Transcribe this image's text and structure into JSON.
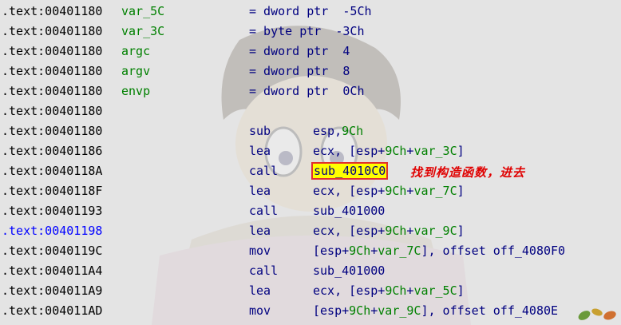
{
  "annotation": "找到构造函数，进去",
  "accent_colors": {
    "highlight": "#ffff00",
    "box": "#e03030",
    "annotation": "#e00000"
  },
  "rows": [
    {
      "addr": ".text:00401180",
      "name": "var_5C",
      "eq": "=",
      "type": "dword ptr",
      "val": "-5Ch"
    },
    {
      "addr": ".text:00401180",
      "name": "var_3C",
      "eq": "=",
      "type": "byte ptr",
      "val": "-3Ch"
    },
    {
      "addr": ".text:00401180",
      "name": "argc",
      "eq": "=",
      "type": "dword ptr",
      "val": "4"
    },
    {
      "addr": ".text:00401180",
      "name": "argv",
      "eq": "=",
      "type": "dword ptr",
      "val": "8"
    },
    {
      "addr": ".text:00401180",
      "name": "envp",
      "eq": "=",
      "type": "dword ptr",
      "val": "0Ch"
    },
    {
      "addr": ".text:00401180"
    },
    {
      "addr": ".text:00401180",
      "mnem": "sub",
      "op1": "esp,",
      "op1num": "9Ch"
    },
    {
      "addr": ".text:00401186",
      "mnem": "lea",
      "op1": "ecx, [esp+",
      "op1num": "9Ch",
      "op1plus": "+",
      "op1ref": "var_3C",
      "op1end": "]"
    },
    {
      "addr": ".text:0040118A",
      "mnem": "call",
      "call": "sub_4010C0"
    },
    {
      "addr": ".text:0040118F",
      "mnem": "lea",
      "op1": "ecx, [esp+",
      "op1num": "9Ch",
      "op1plus": "+",
      "op1ref": "var_7C",
      "op1end": "]"
    },
    {
      "addr": ".text:00401193",
      "mnem": "call",
      "call": "sub_401000"
    },
    {
      "addr": ".text:00401198",
      "mnem": "lea",
      "op1": "ecx, [esp+",
      "op1num": "9Ch",
      "op1plus": "+",
      "op1ref": "var_9C",
      "op1end": "]"
    },
    {
      "addr": ".text:0040119C",
      "mnem": "mov",
      "op1": "[esp+",
      "op1num": "9Ch",
      "op1plus": "+",
      "op1ref": "var_7C",
      "op1end": "], offset off_4080F0"
    },
    {
      "addr": ".text:004011A4",
      "mnem": "call",
      "call": "sub_401000"
    },
    {
      "addr": ".text:004011A9",
      "mnem": "lea",
      "op1": "ecx, [esp+",
      "op1num": "9Ch",
      "op1plus": "+",
      "op1ref": "var_5C",
      "op1end": "]"
    },
    {
      "addr": ".text:004011AD",
      "mnem": "mov",
      "op1": "[esp+",
      "op1num": "9Ch",
      "op1plus": "+",
      "op1ref": "var_9C",
      "op1end": "], offset off_4080E"
    }
  ]
}
